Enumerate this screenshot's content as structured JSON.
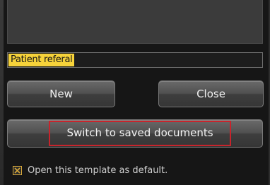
{
  "template": {
    "name_value": "Patient referal"
  },
  "buttons": {
    "new_label": "New",
    "close_label": "Close",
    "switch_label": "Switch to saved documents"
  },
  "default_option": {
    "label": "Open this template as default.",
    "checked": true
  },
  "colors": {
    "background": "#161616",
    "selection_highlight": "#f7d33a",
    "focus_border": "#c8242c",
    "checkbox_border": "#d9a93a"
  }
}
